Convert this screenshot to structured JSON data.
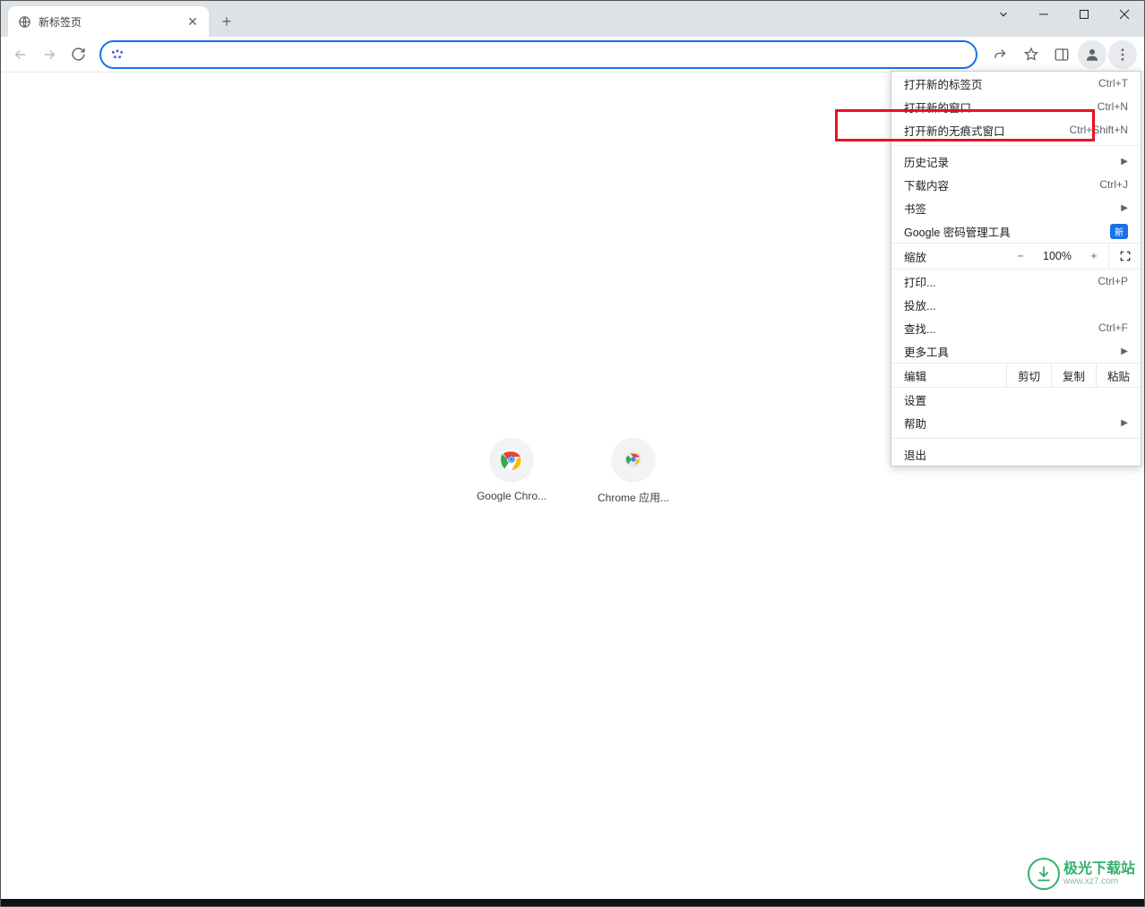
{
  "tab": {
    "title": "新标签页"
  },
  "shortcuts": [
    {
      "label": "Google Chro..."
    },
    {
      "label": "Chrome 应用..."
    }
  ],
  "menu": {
    "new_tab": {
      "label": "打开新的标签页",
      "shortcut": "Ctrl+T"
    },
    "new_window": {
      "label": "打开新的窗口",
      "shortcut": "Ctrl+N"
    },
    "incognito": {
      "label": "打开新的无痕式窗口",
      "shortcut": "Ctrl+Shift+N"
    },
    "history": {
      "label": "历史记录"
    },
    "downloads": {
      "label": "下载内容",
      "shortcut": "Ctrl+J"
    },
    "bookmarks": {
      "label": "书签"
    },
    "passwords": {
      "label": "Google 密码管理工具",
      "badge": "新"
    },
    "zoom": {
      "label": "缩放",
      "value": "100%"
    },
    "print": {
      "label": "打印...",
      "shortcut": "Ctrl+P"
    },
    "cast": {
      "label": "投放..."
    },
    "find": {
      "label": "查找...",
      "shortcut": "Ctrl+F"
    },
    "more_tools": {
      "label": "更多工具"
    },
    "edit": {
      "label": "编辑",
      "cut": "剪切",
      "copy": "复制",
      "paste": "粘贴"
    },
    "settings": {
      "label": "设置"
    },
    "help": {
      "label": "帮助"
    },
    "exit": {
      "label": "退出"
    }
  },
  "watermark": {
    "name": "极光下载站",
    "url": "www.xz7.com"
  }
}
